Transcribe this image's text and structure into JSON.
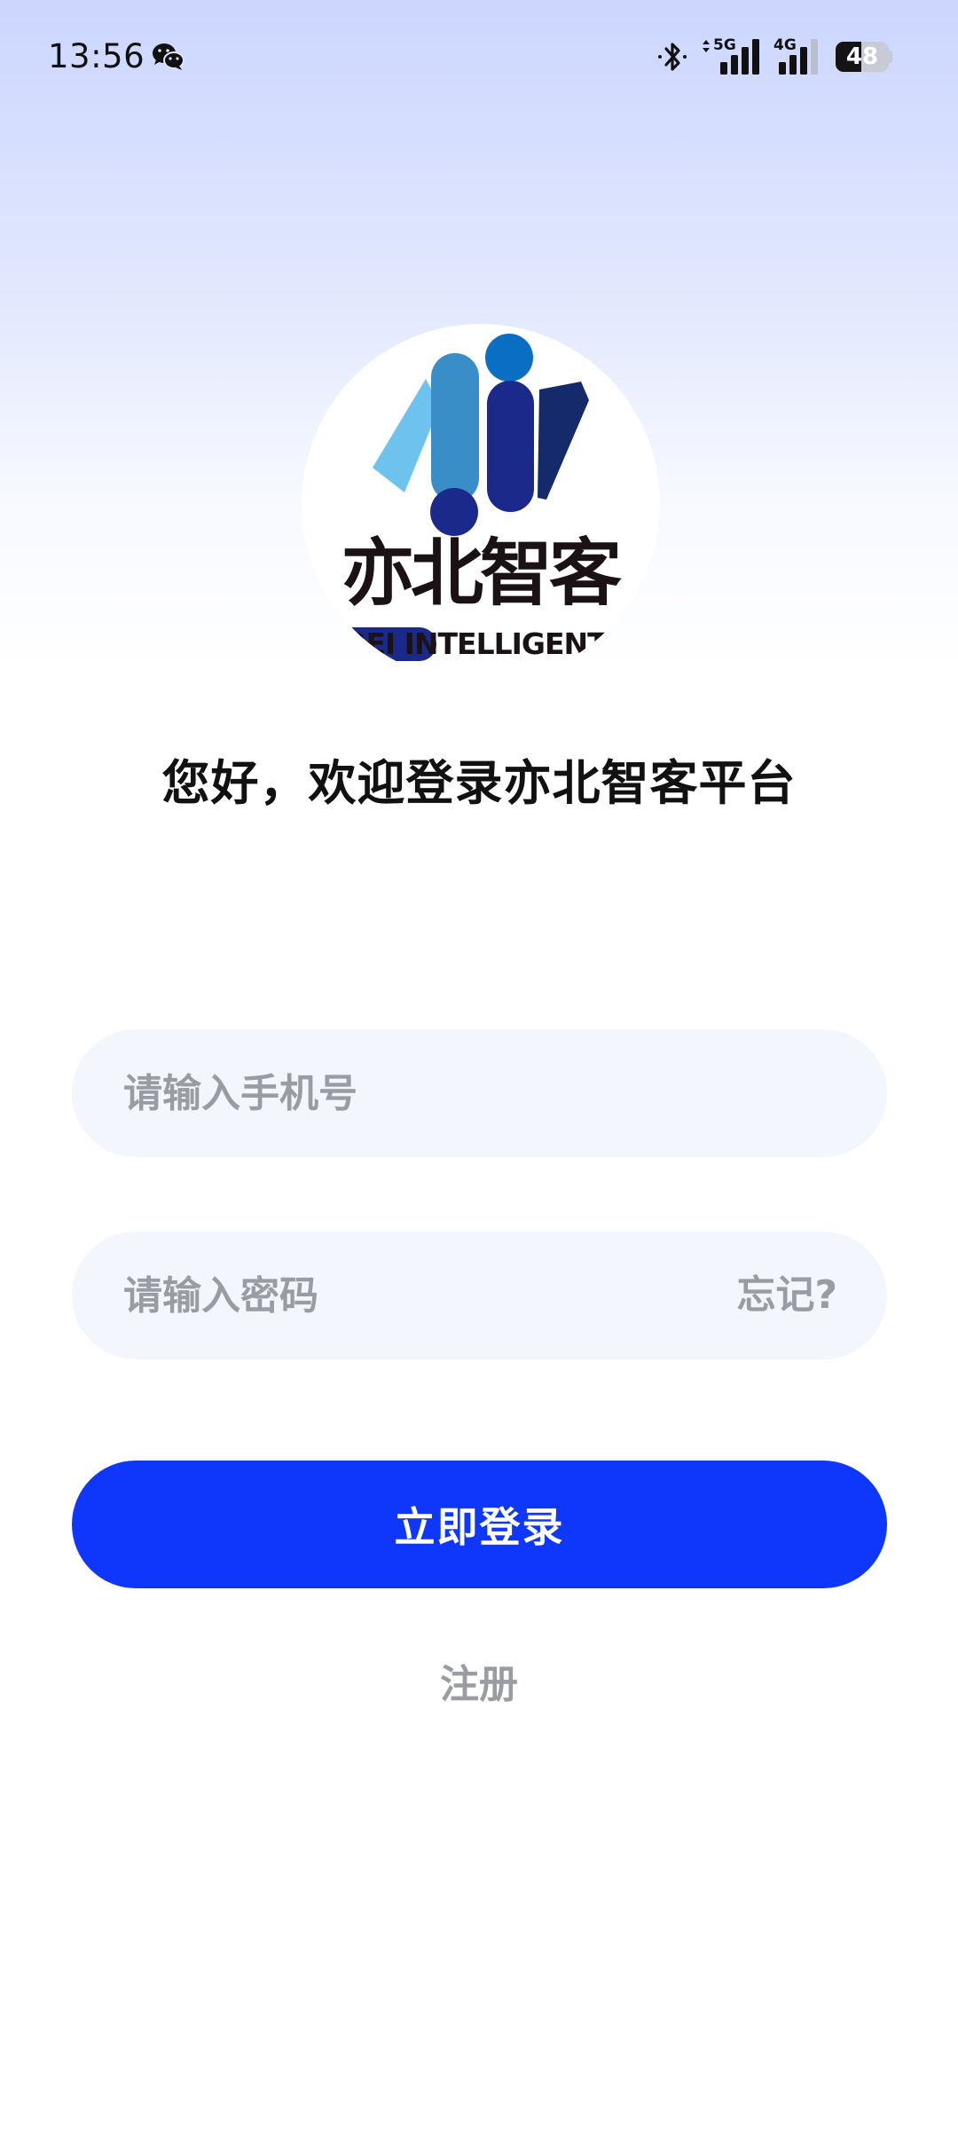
{
  "status_bar": {
    "time": "13:56",
    "network_1": "5G",
    "network_2": "4G",
    "battery_level": 48,
    "battery_text": "48",
    "icons": [
      "wechat-icon",
      "bluetooth-icon",
      "signal-5g-icon",
      "signal-4g-icon",
      "battery-icon"
    ]
  },
  "logo": {
    "name_cn": "亦北智客",
    "name_en": "YIBEI INTELLIGENT",
    "colors": {
      "light_blue": "#6ec3ee",
      "mid_blue": "#3a8ec8",
      "navy": "#1b2a8a",
      "accent_blue": "#0a6fc2",
      "dark_navy": "#142a6a"
    }
  },
  "title": "您好，欢迎登录亦北智客平台",
  "form": {
    "phone_placeholder": "请输入手机号",
    "phone_value": "",
    "password_placeholder": "请输入密码",
    "password_value": "",
    "forgot_label": "忘记?",
    "login_label": "立即登录",
    "register_label": "注册"
  },
  "colors": {
    "primary": "#0e37fb",
    "input_bg": "#f3f6fd",
    "muted_text": "#9a9ca3"
  }
}
